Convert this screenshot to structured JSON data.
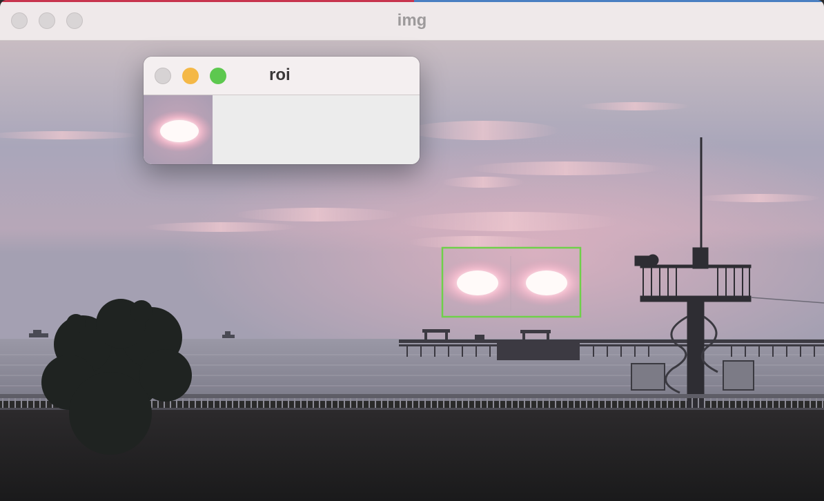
{
  "main_window": {
    "title": "img",
    "accent_colors": [
      "#c8344e",
      "#4a7fc2"
    ],
    "traffic_lights": [
      {
        "name": "close",
        "color": "#d9d5d6"
      },
      {
        "name": "minimize",
        "color": "#d9d5d6"
      },
      {
        "name": "zoom",
        "color": "#d9d5d6"
      }
    ]
  },
  "roi_window": {
    "title": "roi",
    "traffic_lights": [
      {
        "name": "close",
        "color": "#d7d3d4"
      },
      {
        "name": "minimize",
        "color": "#f4b847"
      },
      {
        "name": "zoom",
        "color": "#5dc84f"
      }
    ]
  },
  "selection": {
    "color": "#6fd04a",
    "label": "roi-rectangle"
  },
  "scene": {
    "sky_top": "#c9bdc3",
    "sky_mid": "#a8a5b9",
    "sky_horizon": "#c9a7b6",
    "sea": "#8d8c99",
    "ground": "#232224",
    "sun_color": "#fff6f4",
    "glow_color": "#f3b7c9"
  }
}
